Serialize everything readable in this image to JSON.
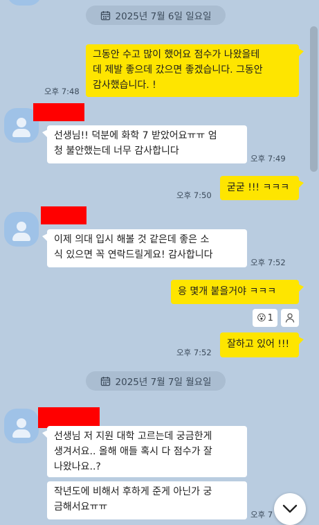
{
  "dates": {
    "first": "2025년 7월 6일 일요일",
    "second": "2025년 7월 7일 월요일"
  },
  "messages": [
    {
      "text": "그동안 수고 많이 했어요 점수가 나왔을테\n데 제발 좋으데 갔으면 좋겠습니다. 그동안\n감사했습니다. !",
      "time": "오후 7:48"
    },
    {
      "text": "선생님!! 덕분에 화학 7 받았어요ㅠㅠ 엄\n청 불안했는데 너무 감사합니다",
      "time": "오후 7:49"
    },
    {
      "text": "굳굳 !!! ㅋㅋㅋ",
      "time": "오후 7:50"
    },
    {
      "text": "이제 의대 입시 해볼 것 같은데 좋은 소\n식 있으면 꼭 연락드릴게요! 감사합니다",
      "time": "오후 7:52"
    },
    {
      "text": "응 몇개 붙을거야 ㅋㅋㅋ",
      "time": ""
    },
    {
      "text": "잘하고 있어 !!!",
      "time": "오후 7:52"
    },
    {
      "text": "선생님 저 지원 대학 고르는데 궁금한게\n생겨서요.. 올해 애들 혹시 다 점수가 잘\n나왔나요..?",
      "time": ""
    },
    {
      "text": "작년도에 비해서 후하게 준게 아닌가 궁\n금해서요ㅠㅠ",
      "time": "오후 7"
    }
  ],
  "reaction": {
    "emoji": "😮",
    "count": "1"
  },
  "colors": {
    "background": "#b9cce0",
    "my_bubble": "#fee500",
    "their_bubble": "#ffffff"
  }
}
